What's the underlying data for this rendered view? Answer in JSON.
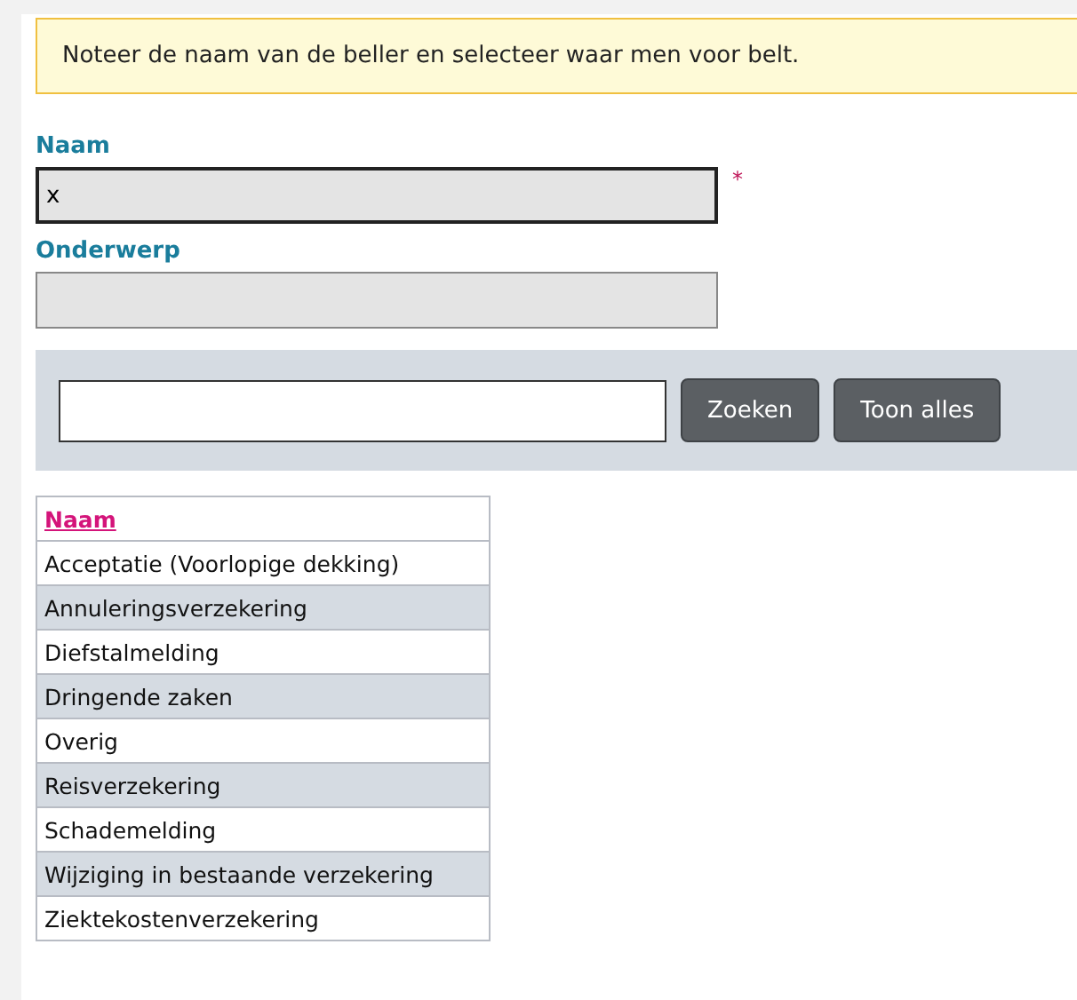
{
  "notice": "Noteer de naam van de beller en selecteer waar men voor belt.",
  "fields": [
    {
      "label": "Naam",
      "value": "x",
      "required": true
    },
    {
      "label": "Onderwerp",
      "required": false
    }
  ],
  "search": {
    "buttons": [
      "Zoeken",
      "Toon alles"
    ]
  },
  "table": {
    "columns": [
      "Naam"
    ],
    "rows": [
      "Acceptatie (Voorlopige dekking)",
      "Annuleringsverzekering",
      "Diefstalmelding",
      "Dringende zaken",
      "Overig",
      "Reisverzekering",
      "Schademelding",
      "Wijziging in bestaande verzekering",
      "Ziektekostenverzekering"
    ]
  },
  "required_mark": "*"
}
